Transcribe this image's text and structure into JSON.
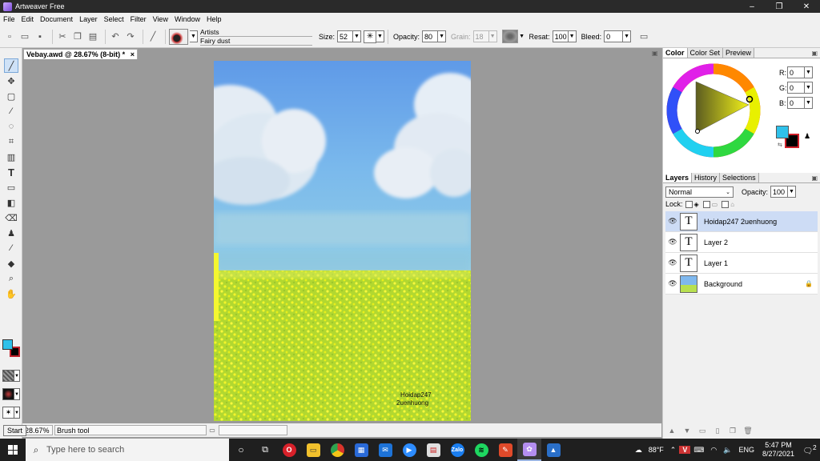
{
  "window": {
    "title": "Artweaver Free",
    "controls": [
      "–",
      "❐",
      "✕"
    ]
  },
  "menu": [
    "File",
    "Edit",
    "Document",
    "Layer",
    "Select",
    "Filter",
    "View",
    "Window",
    "Help"
  ],
  "toolbar": {
    "brush_category": "Artists",
    "brush_variant": "Fairy dust",
    "size_label": "Size:",
    "size_value": "52",
    "opacity_label": "Opacity:",
    "opacity_value": "80",
    "grain_label": "Grain:",
    "grain_value": "18",
    "resat_label": "Resat:",
    "resat_value": "100",
    "bleed_label": "Bleed:",
    "bleed_value": "0"
  },
  "document": {
    "tab_title": "Vebay.awd @ 28.67% (8-bit) *",
    "close": "×"
  },
  "canvas": {
    "text_lines": [
      "Hoidap247",
      "2uenhuong"
    ]
  },
  "status": {
    "zoom": "28.67%",
    "tool": "Brush tool"
  },
  "color_panel": {
    "tabs": [
      "Color",
      "Color Set",
      "Preview"
    ],
    "r_label": "R:",
    "g_label": "G:",
    "b_label": "B:",
    "r": "0",
    "g": "0",
    "b": "0",
    "fg_color": "#2fc1ea",
    "bg_color": "#000000"
  },
  "layers_panel": {
    "tabs": [
      "Layers",
      "History",
      "Selections"
    ],
    "blend_mode": "Normal",
    "opacity_label": "Opacity:",
    "opacity_value": "100",
    "lock_label": "Lock:",
    "layers": [
      {
        "name": "Hoidap247 2uenhuong",
        "selected": true
      },
      {
        "name": "Layer 2",
        "selected": false
      },
      {
        "name": "Layer 1",
        "selected": false
      },
      {
        "name": "Background",
        "selected": false
      }
    ]
  },
  "taskbar": {
    "search_placeholder": "Type here to search",
    "tooltip": "Start",
    "weather": "88°F",
    "language": "ENG",
    "time": "5:47 PM",
    "date": "8/27/2021",
    "notifications": "2"
  }
}
